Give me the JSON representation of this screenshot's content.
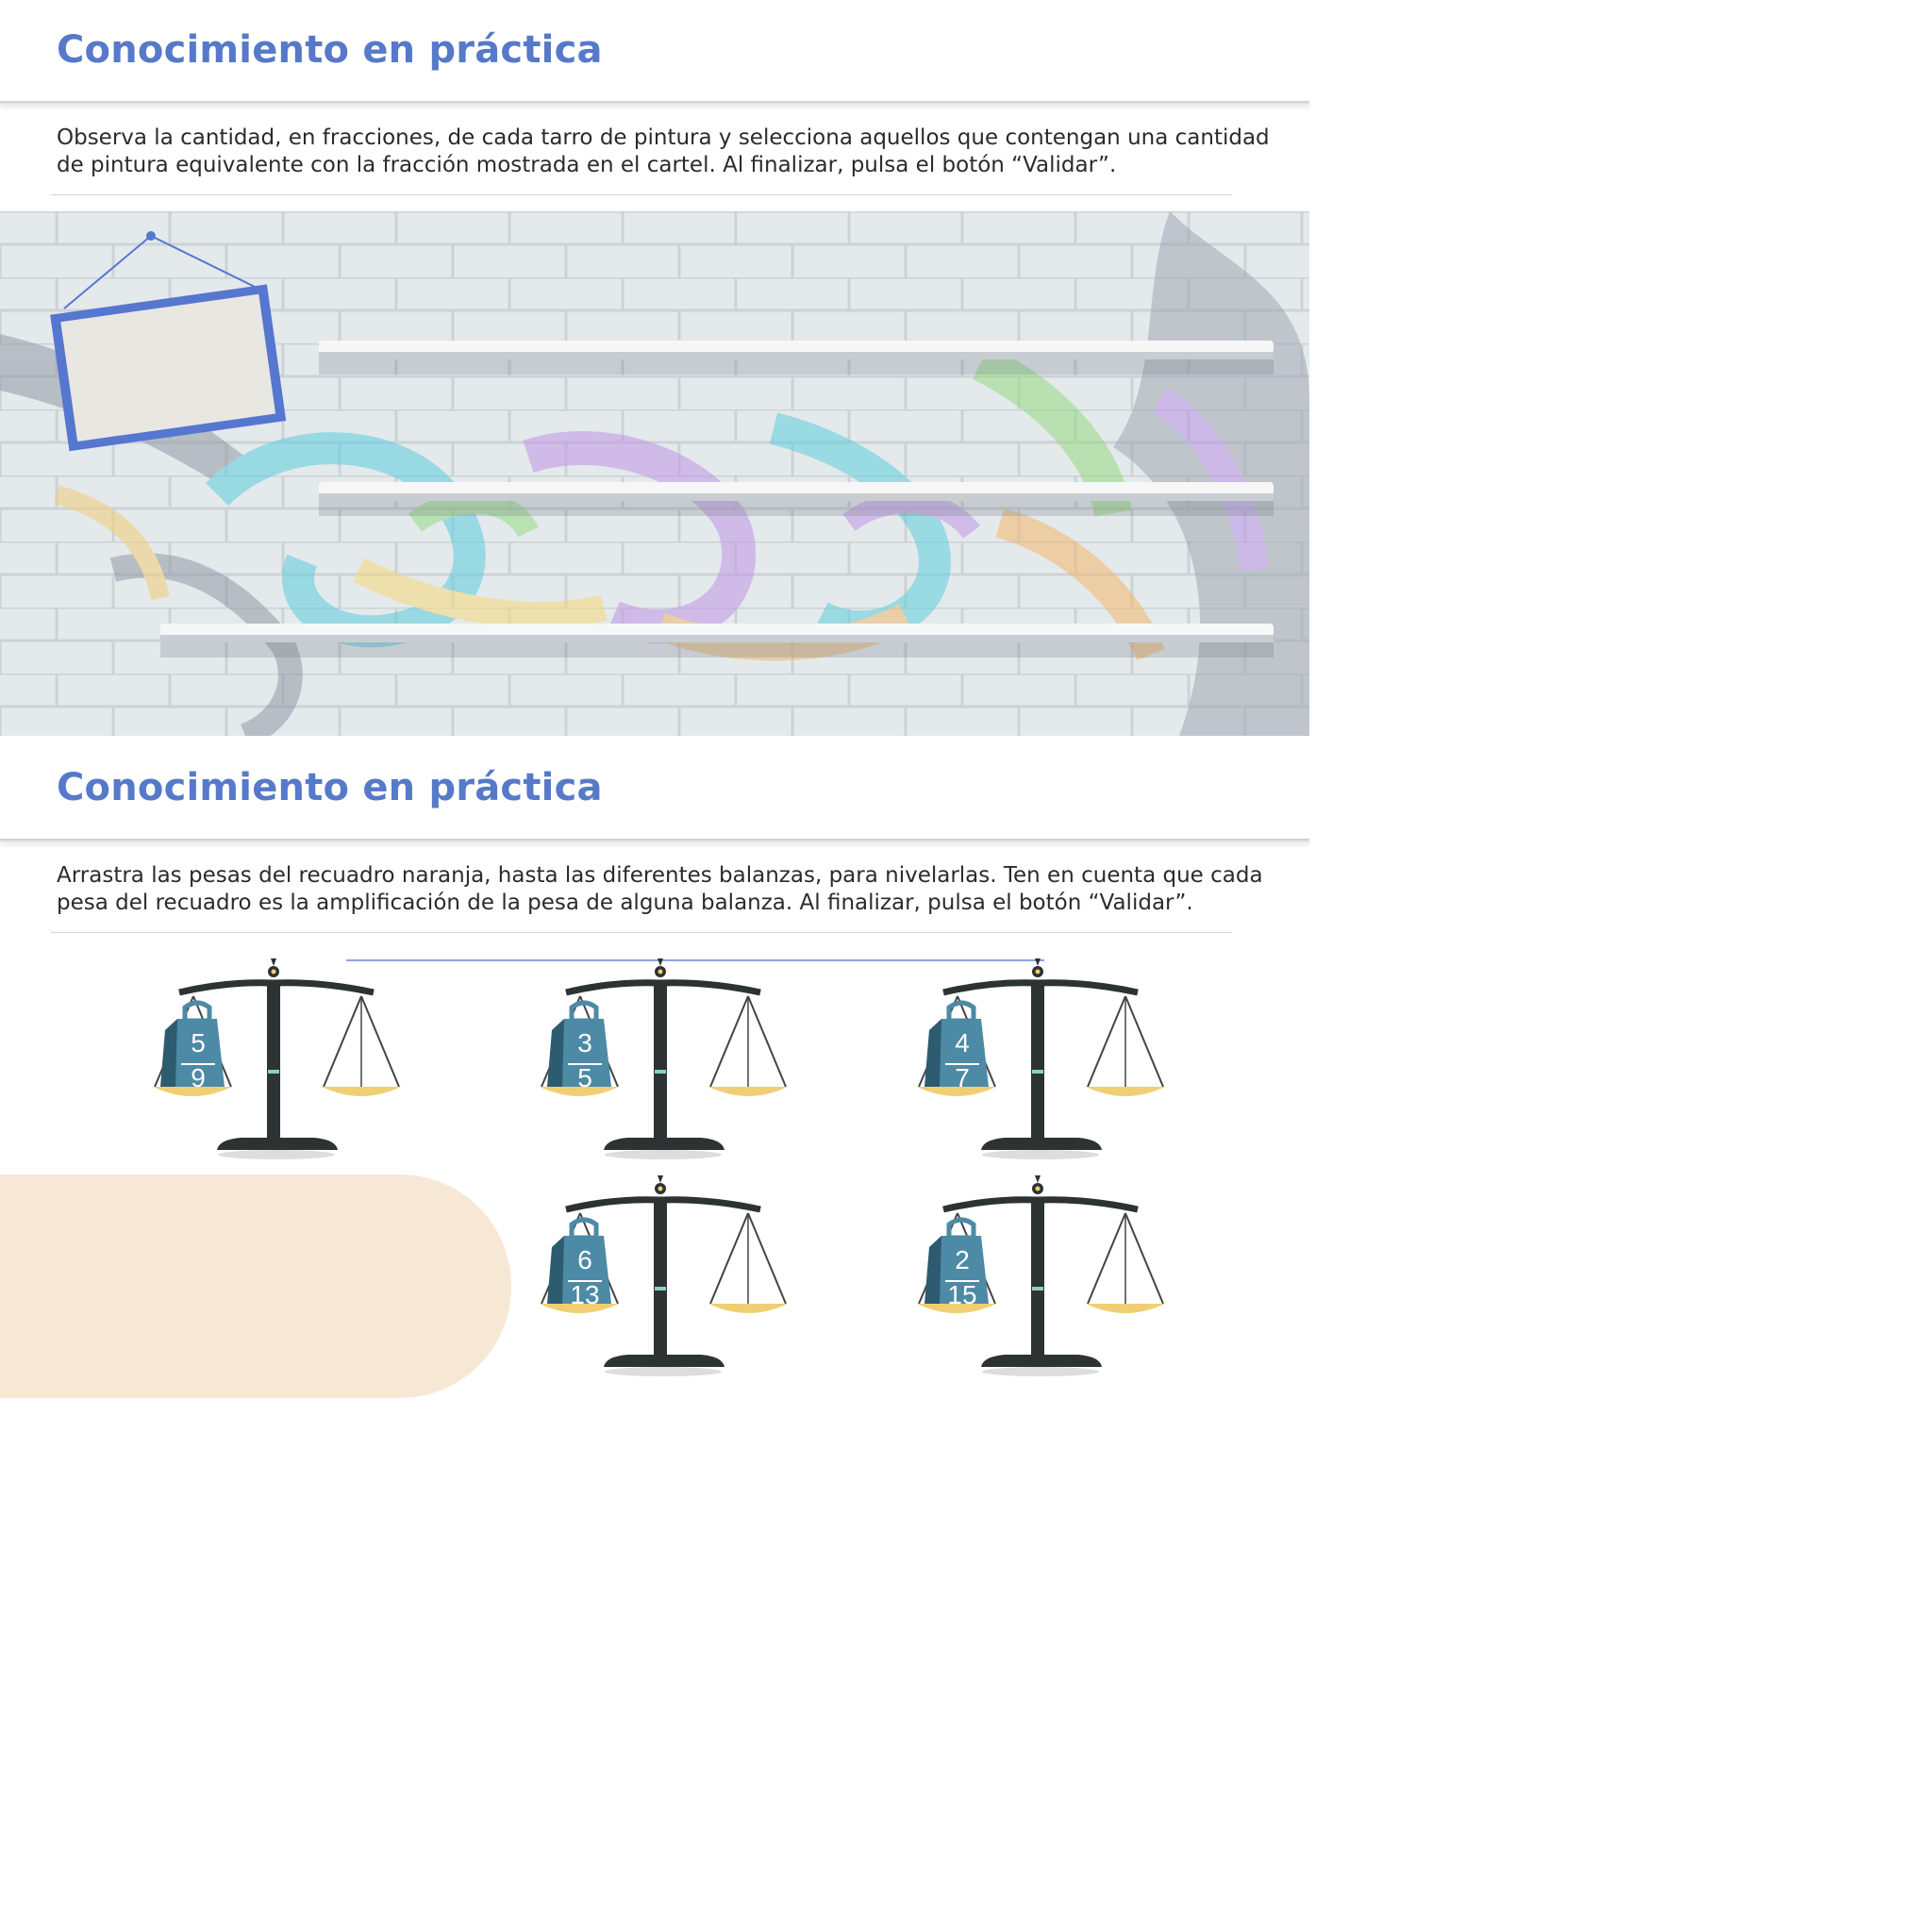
{
  "activity1": {
    "title": "Conocimiento en práctica",
    "instructions": "Observa la cantidad, en fracciones, de cada tarro de pintura y selecciona aquellos que contengan una cantidad de pintura equivalente con la fracción mostrada en el cartel. Al finalizar, pulsa el botón “Validar”.",
    "sign_text": "",
    "shelves": [
      "top",
      "middle",
      "bottom"
    ]
  },
  "activity2": {
    "title": "Conocimiento en práctica",
    "instructions": "Arrastra las pesas del recuadro naranja, hasta las diferentes balanzas, para nivelarlas. Ten en cuenta que cada pesa del recuadro es la amplificación de la pesa de alguna balanza. Al finalizar, pulsa el botón “Validar”.",
    "balances": [
      {
        "numerator": "5",
        "denominator": "9"
      },
      {
        "numerator": "3",
        "denominator": "5"
      },
      {
        "numerator": "4",
        "denominator": "7"
      },
      {
        "numerator": "6",
        "denominator": "13"
      },
      {
        "numerator": "2",
        "denominator": "15"
      }
    ],
    "tray_weights": []
  },
  "colors": {
    "accent": "#5679c9",
    "weight": "#4d8aa6",
    "pan": "#f0cf74",
    "balance_body": "#2d3233",
    "tray": "#f7e8d5",
    "sign_frame": "#5677d0"
  }
}
